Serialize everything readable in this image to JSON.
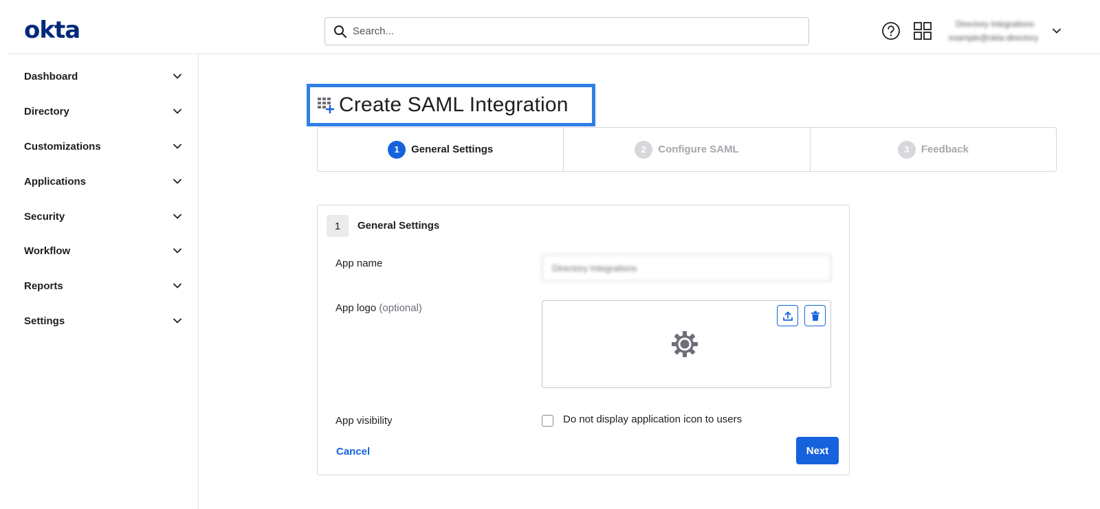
{
  "header": {
    "logo_text": "okta",
    "search_placeholder": "Search...",
    "user_org": "Directory Integrations",
    "user_email": "example@okta-directory"
  },
  "sidebar": {
    "items": [
      {
        "label": "Dashboard"
      },
      {
        "label": "Directory"
      },
      {
        "label": "Customizations"
      },
      {
        "label": "Applications"
      },
      {
        "label": "Security"
      },
      {
        "label": "Workflow"
      },
      {
        "label": "Reports"
      },
      {
        "label": "Settings"
      }
    ]
  },
  "page": {
    "title": "Create SAML Integration"
  },
  "steps": [
    {
      "number": "1",
      "label": "General Settings",
      "state": "active"
    },
    {
      "number": "2",
      "label": "Configure SAML",
      "state": "inactive"
    },
    {
      "number": "3",
      "label": "Feedback",
      "state": "inactive"
    }
  ],
  "form": {
    "section_number": "1",
    "section_title": "General Settings",
    "app_name_label": "App name",
    "app_name_value": "Directory Integrations",
    "app_logo_label": "App logo",
    "app_logo_optional": "(optional)",
    "app_visibility_label": "App visibility",
    "visibility_checkbox_label": "Do not display application icon to users",
    "visibility_checked": false,
    "cancel_label": "Cancel",
    "next_label": "Next"
  },
  "colors": {
    "brand": "#00297a",
    "primary": "#1662dd",
    "highlight": "#2f7fe6"
  }
}
